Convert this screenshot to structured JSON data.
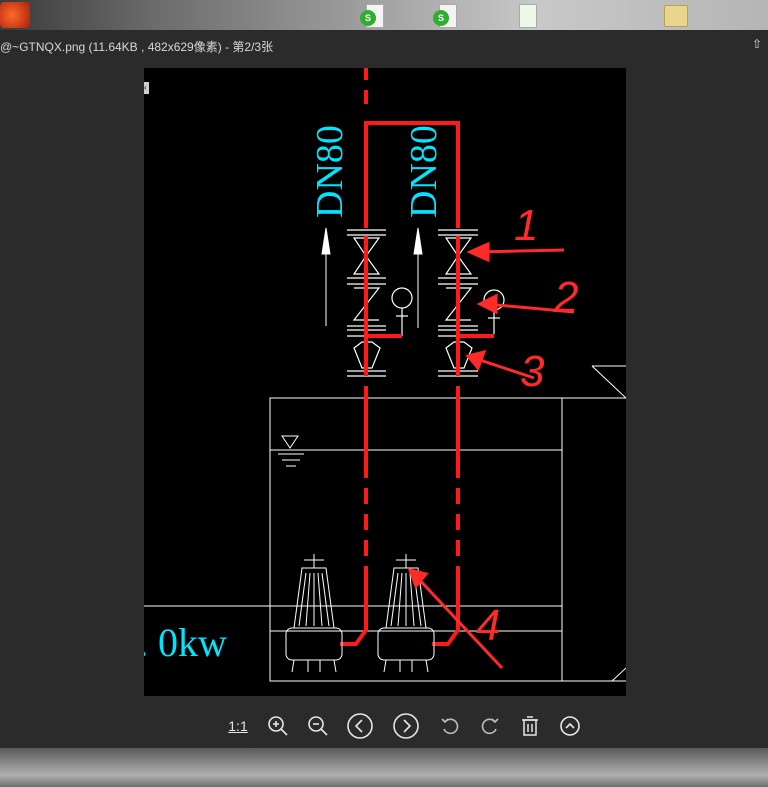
{
  "window": {
    "title": "@~GTNQX.png (11.64KB , 482x629像素) - 第2/3张",
    "pin_icon": "pin-icon"
  },
  "desktop": {
    "icons": [
      "app-icon",
      "spreadsheet-file-icon",
      "spreadsheet-file-icon",
      "spreadsheet-file-icon",
      "folder-icon"
    ]
  },
  "drawing": {
    "labels": {
      "pipe_left": "DN80",
      "pipe_right": "DN80",
      "power": ". 0kw"
    },
    "annotations": [
      "1",
      "2",
      "3",
      "4"
    ],
    "colors": {
      "pipe": "#ff1a1a",
      "label": "#00e5ff",
      "line": "#ffffff",
      "annotation": "#ff2a2a"
    }
  },
  "toolbar": {
    "actual_size": "1:1",
    "buttons": [
      "zoom-in-icon",
      "zoom-out-icon",
      "previous-icon",
      "next-icon",
      "rotate-left-icon",
      "rotate-right-icon",
      "delete-icon",
      "more-icon"
    ]
  }
}
